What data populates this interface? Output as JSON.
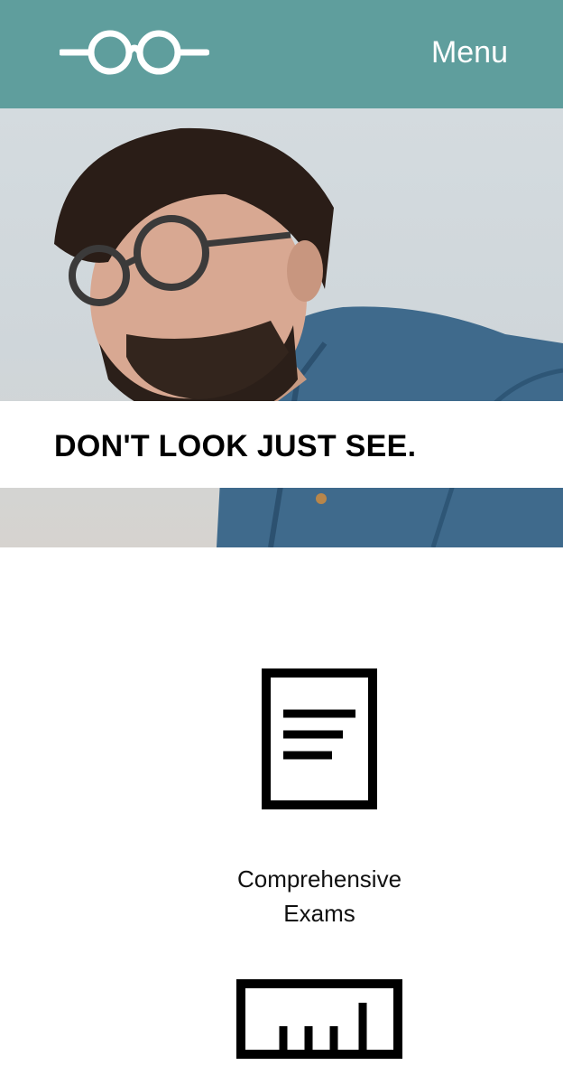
{
  "header": {
    "logo_icon": "glasses-icon",
    "menu_label": "Menu",
    "background_color": "#5f9e9d"
  },
  "hero": {
    "tagline": "DON'T LOOK JUST SEE."
  },
  "features": [
    {
      "icon": "document-icon",
      "label_line1": "Comprehensive",
      "label_line2": "Exams"
    },
    {
      "icon": "ruler-icon"
    }
  ]
}
